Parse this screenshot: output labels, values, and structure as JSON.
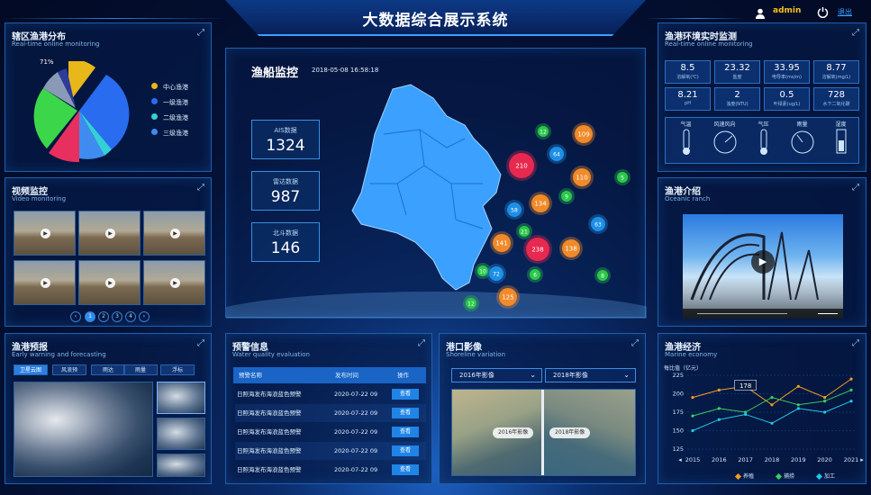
{
  "header": {
    "title": "大数据综合展示系统",
    "user": "admin",
    "logout": "退出"
  },
  "distribution": {
    "title": "辖区渔港分布",
    "subtitle": "Real-time online monitoring",
    "percent_label": "71%",
    "legend": [
      {
        "label": "中心渔港",
        "color": "#e8b81a"
      },
      {
        "label": "一级渔港",
        "color": "#2a6cf0"
      },
      {
        "label": "二级渔港",
        "color": "#34d0d8"
      },
      {
        "label": "三级渔港",
        "color": "#3f8cf0"
      }
    ]
  },
  "video": {
    "title": "视频监控",
    "subtitle": "Video monitoring",
    "pages": [
      "1",
      "2",
      "3",
      "4"
    ]
  },
  "forecast": {
    "title": "渔港预报",
    "subtitle": "Early warning and forecasting",
    "tabs": [
      "卫星云图",
      "风浪预",
      "雨达",
      "雨量",
      "浮标"
    ]
  },
  "monitor": {
    "title": "渔船监控",
    "time": "2018-05-08 16:58:18",
    "stats": [
      {
        "label": "AIS数据",
        "value": "1324"
      },
      {
        "label": "雷达数据",
        "value": "987"
      },
      {
        "label": "北斗数据",
        "value": "146"
      }
    ],
    "markers": [
      "210",
      "109",
      "64",
      "12",
      "110",
      "5",
      "134",
      "9",
      "58",
      "63",
      "21",
      "141",
      "238",
      "138",
      "10",
      "72",
      "6",
      "8",
      "125",
      "12"
    ]
  },
  "warning": {
    "title": "预警信息",
    "subtitle": "Water quality evaluation",
    "headers": [
      "预警名称",
      "发布时间",
      "操作"
    ],
    "rows": [
      {
        "name": "日照海发布海浪蓝色预警",
        "time": "2020-07-22 09",
        "action": "查看"
      },
      {
        "name": "日照海发布海浪蓝色预警",
        "time": "2020-07-22 09",
        "action": "查看"
      },
      {
        "name": "日照海发布海浪蓝色预警",
        "time": "2020-07-22 09",
        "action": "查看"
      },
      {
        "name": "日照海发布海浪蓝色预警",
        "time": "2020-07-22 09",
        "action": "查看"
      },
      {
        "name": "日照海发布海浪蓝色预警",
        "time": "2020-07-22 09",
        "action": "查看"
      }
    ]
  },
  "port_image": {
    "title": "港口影像",
    "subtitle": "Shoreline variation",
    "select_left": "2016年影像",
    "select_right": "2018年影像",
    "label_left": "2016年影像",
    "label_right": "2018年影像"
  },
  "environment": {
    "title": "渔港环境实时监测",
    "subtitle": "Real-time online monitoring",
    "cells": [
      {
        "value": "8.5",
        "label": "溶解氧(℃)"
      },
      {
        "value": "23.32",
        "label": "盐度"
      },
      {
        "value": "33.95",
        "label": "电导率(ms/m)"
      },
      {
        "value": "8.77",
        "label": "溶解氧(mg/L)"
      },
      {
        "value": "8.21",
        "label": "pH"
      },
      {
        "value": "2",
        "label": "浊度(NTU)"
      },
      {
        "value": "0.5",
        "label": "叶绿素(ug/L)"
      },
      {
        "value": "728",
        "label": "水下二氧化碳"
      }
    ],
    "gauges": [
      "气温",
      "风速风向",
      "气压",
      "雨量",
      "湿度"
    ]
  },
  "intro": {
    "title": "渔港介绍",
    "subtitle": "Oceanic ranch"
  },
  "economy": {
    "title": "渔港经济",
    "subtitle": "Marine economy",
    "tooltip": "178"
  },
  "chart_data": {
    "type": "line",
    "ylabel": "每比值（亿元）",
    "x": [
      "2015",
      "2016",
      "2017",
      "2018",
      "2019",
      "2020",
      "2021"
    ],
    "ylim": [
      125,
      225
    ],
    "yticks": [
      "225",
      "200",
      "175",
      "150",
      "125"
    ],
    "series": [
      {
        "name": "养殖",
        "color": "#f0a020",
        "values": [
          195,
          205,
          210,
          185,
          210,
          195,
          220
        ]
      },
      {
        "name": "捕捞",
        "color": "#38d060",
        "values": [
          170,
          180,
          175,
          195,
          185,
          190,
          205
        ]
      },
      {
        "name": "加工",
        "color": "#20c8e8",
        "values": [
          150,
          165,
          172,
          160,
          180,
          175,
          190
        ]
      }
    ]
  }
}
